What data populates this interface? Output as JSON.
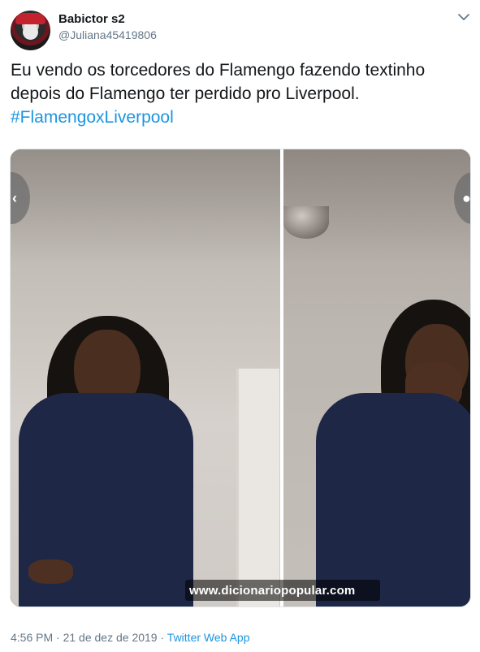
{
  "author": {
    "display_name": "Babictor s2",
    "handle": "@Juliana45419806"
  },
  "tweet": {
    "line1": "Eu vendo os torcedores do Flamengo fazendo textinho",
    "line2": "depois do Flamengo ter perdido pro Liverpool.",
    "hashtag": "#FlamengoxLiverpool"
  },
  "media": {
    "watermark": "www.dicionariopopular.com",
    "prev_glyph": "‹",
    "next_glyph": "●"
  },
  "meta": {
    "time": "4:56 PM",
    "separator": " · ",
    "date": "21 de dez de 2019",
    "source": "Twitter Web App"
  },
  "icons": {
    "menu": "chevron-down-icon"
  },
  "colors": {
    "text": "#14171a",
    "secondary": "#657786",
    "link": "#1b95e0",
    "border": "#e1e8ed"
  }
}
